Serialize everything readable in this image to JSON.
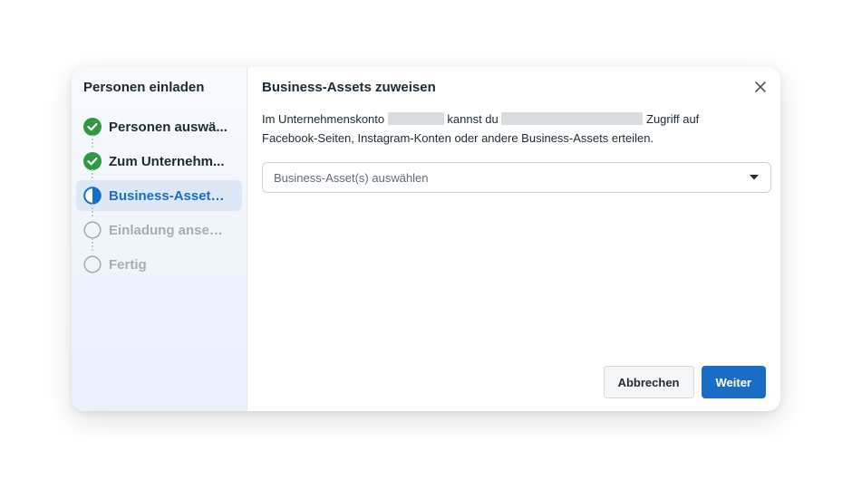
{
  "sidebar": {
    "title": "Personen einladen",
    "steps": [
      {
        "label": "Personen auswä...",
        "status": "done",
        "icon": "check-circle-icon"
      },
      {
        "label": "Zum Unternehm...",
        "status": "done",
        "icon": "check-circle-icon"
      },
      {
        "label": "Business-Assets ...",
        "status": "current",
        "icon": "half-circle-icon"
      },
      {
        "label": "Einladung ansehen",
        "status": "pending",
        "icon": "empty-circle-icon"
      },
      {
        "label": "Fertig",
        "status": "pending",
        "icon": "empty-circle-icon"
      }
    ]
  },
  "main": {
    "title": "Business-Assets zuweisen",
    "description": {
      "part1": "Im Unternehmenskonto",
      "part2": "kannst du",
      "part3": "Zugriff auf Facebook-Seiten, Instagram-Konten oder andere Business-Assets erteilen."
    },
    "select": {
      "placeholder": "Business-Asset(s) auswählen",
      "icon": "caret-down-icon"
    }
  },
  "footer": {
    "cancel_label": "Abbrechen",
    "next_label": "Weiter"
  },
  "colors": {
    "accent": "#1a6dc5",
    "success": "#2e9a44",
    "pending": "#a6adb5",
    "text": "#1c2b33"
  }
}
